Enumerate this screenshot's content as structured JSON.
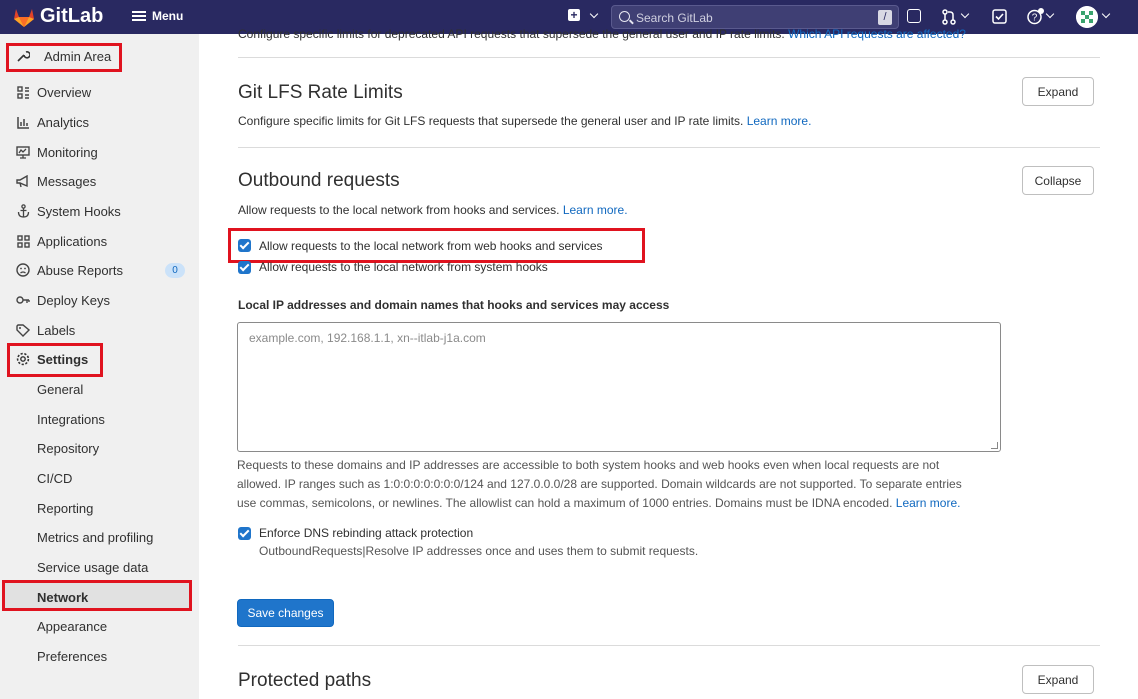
{
  "header": {
    "brand": "GitLab",
    "menu_label": "Menu",
    "search_placeholder": "Search GitLab",
    "search_shortcut": "/"
  },
  "sidebar": {
    "section_title": "Admin Area",
    "items": [
      {
        "label": "Overview",
        "icon": "overview-icon"
      },
      {
        "label": "Analytics",
        "icon": "analytics-icon"
      },
      {
        "label": "Monitoring",
        "icon": "monitoring-icon"
      },
      {
        "label": "Messages",
        "icon": "megaphone-icon"
      },
      {
        "label": "System Hooks",
        "icon": "anchor-icon"
      },
      {
        "label": "Applications",
        "icon": "applications-icon"
      },
      {
        "label": "Abuse Reports",
        "icon": "abuse-icon",
        "badge": "0"
      },
      {
        "label": "Deploy Keys",
        "icon": "key-icon"
      },
      {
        "label": "Labels",
        "icon": "label-icon"
      },
      {
        "label": "Settings",
        "icon": "gear-icon"
      }
    ],
    "settings_sub": [
      "General",
      "Integrations",
      "Repository",
      "CI/CD",
      "Reporting",
      "Metrics and profiling",
      "Service usage data",
      "Network",
      "Appearance",
      "Preferences"
    ],
    "active_item": "Network"
  },
  "main": {
    "cut_text": "Configure specific limits for deprecated API requests that supersede the general user and IP rate limits.",
    "cut_link": "Which API requests are affected?",
    "lfs": {
      "title": "Git LFS Rate Limits",
      "desc": "Configure specific limits for Git LFS requests that supersede the general user and IP rate limits.",
      "link": "Learn more.",
      "button": "Expand"
    },
    "outbound": {
      "title": "Outbound requests",
      "desc": "Allow requests to the local network from hooks and services.",
      "link": "Learn more.",
      "button": "Collapse",
      "cb1": "Allow requests to the local network from web hooks and services",
      "cb2": "Allow requests to the local network from system hooks",
      "field_label": "Local IP addresses and domain names that hooks and services may access",
      "field_placeholder": "example.com, 192.168.1.1, xn--itlab-j1a.com",
      "help_line1": "Requests to these domains and IP addresses are accessible to both system hooks and web hooks even when local requests are not",
      "help_line2": "allowed. IP ranges such as 1:0:0:0:0:0:0:0/124 and 127.0.0.0/28 are supported. Domain wildcards are not supported. To separate entries",
      "help_line3": "use commas, semicolons, or newlines. The allowlist can hold a maximum of 1000 entries. Domains must be IDNA encoded.",
      "help_link": "Learn more.",
      "dns_label": "Enforce DNS rebinding attack protection",
      "dns_help": "OutboundRequests|Resolve IP addresses once and uses them to submit requests.",
      "save": "Save changes"
    },
    "protected": {
      "title": "Protected paths",
      "button": "Expand"
    }
  },
  "colors": {
    "topbar": "#292961",
    "primary": "#1f75cb",
    "highlight": "#e0131f"
  }
}
